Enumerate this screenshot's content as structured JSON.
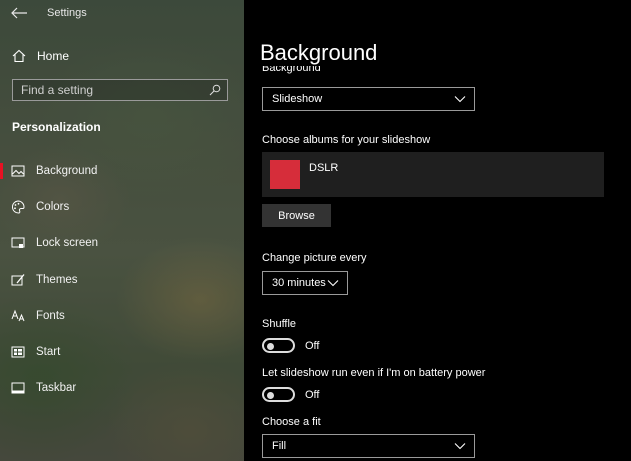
{
  "window": {
    "title": "Settings"
  },
  "sidebar": {
    "home_label": "Home",
    "search_placeholder": "Find a setting",
    "section_title": "Personalization",
    "items": [
      {
        "label": "Background",
        "icon": "picture-icon",
        "selected": true
      },
      {
        "label": "Colors",
        "icon": "palette-icon",
        "selected": false
      },
      {
        "label": "Lock screen",
        "icon": "lock-screen-icon",
        "selected": false
      },
      {
        "label": "Themes",
        "icon": "themes-icon",
        "selected": false
      },
      {
        "label": "Fonts",
        "icon": "fonts-icon",
        "selected": false
      },
      {
        "label": "Start",
        "icon": "start-icon",
        "selected": false
      },
      {
        "label": "Taskbar",
        "icon": "taskbar-icon",
        "selected": false
      }
    ]
  },
  "main": {
    "title": "Background",
    "background_label": "Background",
    "background_value": "Slideshow",
    "albums_label": "Choose albums for your slideshow",
    "album": {
      "name": "DSLR",
      "color": "#d62d3a"
    },
    "browse_label": "Browse",
    "interval_label": "Change picture every",
    "interval_value": "30 minutes",
    "shuffle_label": "Shuffle",
    "shuffle_state": "Off",
    "battery_label": "Let slideshow run even if I'm on battery power",
    "battery_state": "Off",
    "fit_label": "Choose a fit",
    "fit_value": "Fill"
  },
  "colors": {
    "accent": "#e81123",
    "album_thumb": "#d62d3a",
    "button_bg": "#333333"
  }
}
